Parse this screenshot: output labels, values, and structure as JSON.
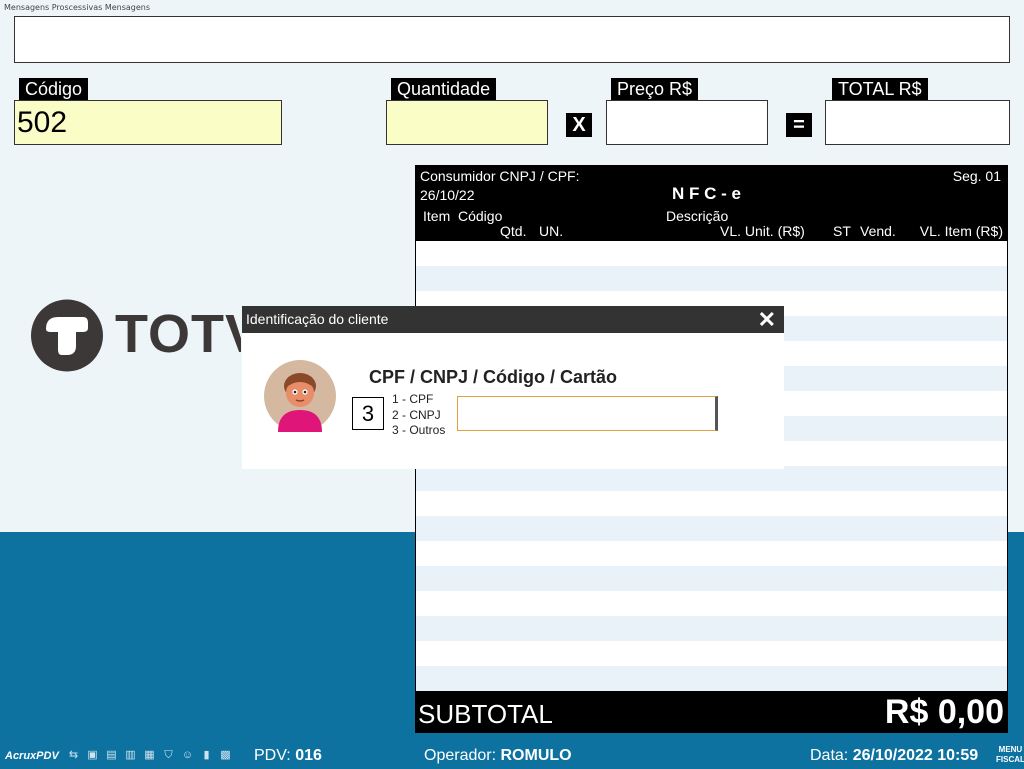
{
  "messages": {
    "caption": "Mensagens Proscessivas Mensagens",
    "text": ""
  },
  "fields": {
    "codigo": {
      "label": "Código",
      "value": "502"
    },
    "quantidade": {
      "label": "Quantidade",
      "value": ""
    },
    "multiply": "X",
    "preco": {
      "label": "Preço R$",
      "value": ""
    },
    "equals": "=",
    "total": {
      "label": "TOTAL R$",
      "value": ""
    }
  },
  "logo": {
    "text": "TOTV"
  },
  "receipt": {
    "consumer_label": "Consumidor CNPJ / CPF:",
    "segment": "Seg. 01",
    "date": "26/10/22",
    "doc_type": "N F C - e",
    "columns": {
      "item": "Item",
      "codigo": "Código",
      "descricao": "Descrição",
      "qtd": "Qtd.",
      "un": "UN.",
      "vl_unit": "VL. Unit. (R$)",
      "st": "ST",
      "vend": "Vend.",
      "vl_item": "VL. Item (R$)"
    },
    "subtotal_label": "SUBTOTAL",
    "subtotal_value": "R$ 0,00"
  },
  "dialog": {
    "title": "Identificação do cliente",
    "heading": "CPF / CNPJ / Código / Cartão",
    "selected_option": "3",
    "options": [
      "1 - CPF",
      "2 - CNPJ",
      "3 - Outros"
    ],
    "input_value": ""
  },
  "status": {
    "app_name": "AcruxPDV",
    "pdv_label": "PDV:",
    "pdv_value": "016",
    "operator_label": "Operador:",
    "operator_value": "ROMULO",
    "date_label": "Data:",
    "date_value": "26/10/2022 10:59",
    "menu_fiscal_line1": "MENU",
    "menu_fiscal_line2": "FISCAL"
  },
  "colors": {
    "accent_blue": "#0d72a0",
    "field_yellow": "#fbfdc6",
    "dialog_bar": "#333333"
  }
}
